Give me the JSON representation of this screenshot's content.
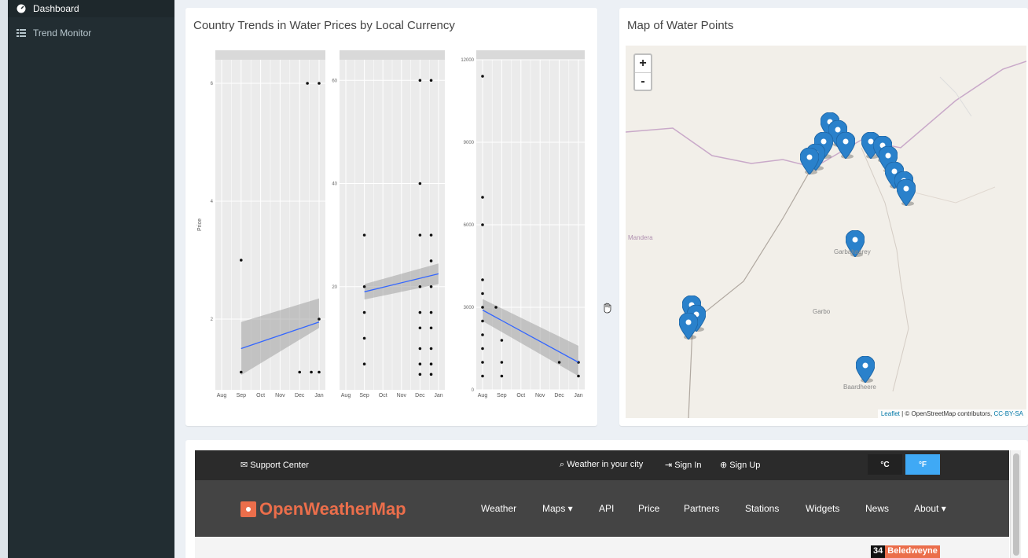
{
  "sidebar": {
    "items": [
      {
        "label": "Dashboard",
        "icon": "dashboard-icon"
      },
      {
        "label": "Trend Monitor",
        "icon": "grid-icon"
      }
    ]
  },
  "trends": {
    "title": "Country Trends in Water Prices by Local Currency",
    "ylabel": "Price"
  },
  "chart_data": {
    "type": "scatter",
    "panels": [
      {
        "x_ticks": [
          "Aug",
          "Sep",
          "Oct",
          "Nov",
          "Dec",
          "Jan"
        ],
        "y_ticks": [
          "2",
          "4",
          "6"
        ],
        "ylim": [
          0.8,
          6.4
        ],
        "points": [
          [
            1,
            1.1
          ],
          [
            1,
            3.0
          ],
          [
            4,
            1.1
          ],
          [
            4.6,
            1.1
          ],
          [
            5,
            1.1
          ],
          [
            5,
            2.0
          ],
          [
            4.4,
            6.0
          ],
          [
            5,
            6.0
          ]
        ],
        "trend": [
          [
            1,
            1.5
          ],
          [
            5,
            1.95
          ]
        ],
        "band_lower": [
          [
            1,
            1.05
          ],
          [
            5,
            1.85
          ]
        ],
        "band_upper": [
          [
            1,
            1.95
          ],
          [
            5,
            2.35
          ]
        ]
      },
      {
        "x_ticks": [
          "Aug",
          "Sep",
          "Oct",
          "Nov",
          "Dec",
          "Jan"
        ],
        "y_ticks": [
          "20",
          "40",
          "60"
        ],
        "ylim": [
          0,
          64
        ],
        "points": [
          [
            1,
            30
          ],
          [
            1,
            10
          ],
          [
            1,
            5
          ],
          [
            1,
            15
          ],
          [
            1,
            20
          ],
          [
            4,
            30
          ],
          [
            4.6,
            30
          ],
          [
            4,
            40
          ],
          [
            4,
            20
          ],
          [
            4,
            15
          ],
          [
            4,
            12
          ],
          [
            4,
            8
          ],
          [
            4,
            5
          ],
          [
            4,
            3
          ],
          [
            4.6,
            25
          ],
          [
            4.6,
            20
          ],
          [
            4.6,
            15
          ],
          [
            4.6,
            12
          ],
          [
            4.6,
            8
          ],
          [
            4.6,
            5
          ],
          [
            4.6,
            3
          ],
          [
            4,
            60
          ],
          [
            4.6,
            60
          ]
        ],
        "trend": [
          [
            1,
            19
          ],
          [
            5,
            22.5
          ]
        ],
        "band_lower": [
          [
            1,
            17.5
          ],
          [
            5,
            20.5
          ]
        ],
        "band_upper": [
          [
            1,
            20.5
          ],
          [
            5,
            24.5
          ]
        ]
      },
      {
        "x_ticks": [
          "Aug",
          "Sep",
          "Oct",
          "Nov",
          "Dec",
          "Jan"
        ],
        "y_ticks": [
          "0",
          "3000",
          "6000",
          "9000",
          "12000"
        ],
        "ylim": [
          0,
          12000
        ],
        "points": [
          [
            0,
            11400
          ],
          [
            0,
            7000
          ],
          [
            0,
            6000
          ],
          [
            0,
            4000
          ],
          [
            0,
            3500
          ],
          [
            0,
            3000
          ],
          [
            0,
            2500
          ],
          [
            0,
            2000
          ],
          [
            0,
            1500
          ],
          [
            0,
            1000
          ],
          [
            0,
            500
          ],
          [
            1,
            1800
          ],
          [
            1,
            1000
          ],
          [
            1,
            500
          ],
          [
            4,
            1000
          ],
          [
            5,
            1000
          ],
          [
            5,
            500
          ],
          [
            0.7,
            3000
          ]
        ],
        "trend": [
          [
            0,
            2900
          ],
          [
            5,
            1000
          ]
        ],
        "band_lower": [
          [
            0,
            2500
          ],
          [
            5,
            500
          ]
        ],
        "band_upper": [
          [
            0,
            3300
          ],
          [
            5,
            1600
          ]
        ]
      }
    ]
  },
  "map": {
    "title": "Map of Water Points",
    "zoom_in": "+",
    "zoom_out": "-",
    "labels": {
      "garbahaarey": "Garbahaarey",
      "garbo": "Garbo",
      "mandera": "Mandera",
      "baardheere": "Baardheere"
    },
    "attribution": {
      "leaflet": "Leaflet",
      "sep": "|",
      "osm": "© OpenStreetMap contributors,",
      "license": "CC-BY-SA"
    }
  },
  "owm": {
    "support": "Support Center",
    "weather_city": "Weather in your city",
    "sign_in": "Sign In",
    "sign_up": "Sign Up",
    "unit_c": "°C",
    "unit_f": "°F",
    "brand": "OpenWeatherMap",
    "nav": [
      "Weather",
      "Maps ▾",
      "API",
      "Price",
      "Partners",
      "Stations",
      "Widgets",
      "News",
      "About ▾"
    ],
    "badge_num": "34",
    "badge_city": "Beledweyne"
  }
}
